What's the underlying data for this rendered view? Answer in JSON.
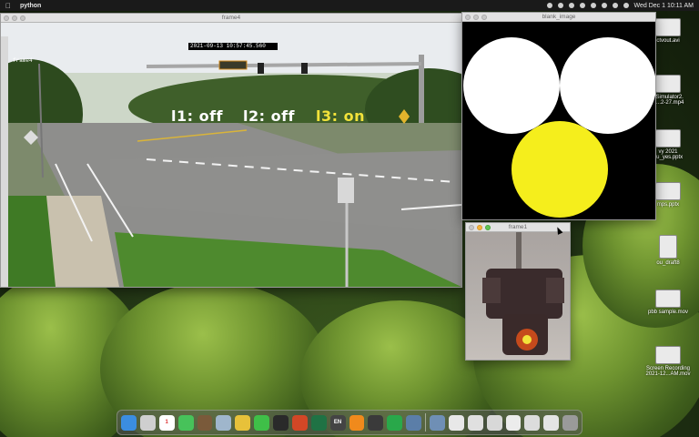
{
  "menubar": {
    "app_name": "python",
    "datetime": "Wed Dec 1  10:11 AM"
  },
  "windows": {
    "frame4": {
      "title": "frame4",
      "label": "frame4",
      "timestamp": "2021-09-13 10:57:45.560",
      "status": [
        {
          "label": "l1:",
          "state": "off",
          "color": "#ffffff"
        },
        {
          "label": "l2:",
          "state": "off",
          "color": "#ffffff"
        },
        {
          "label": "l3:",
          "state": "on",
          "color": "#f2e23a"
        }
      ]
    },
    "blank_image": {
      "title": "blank_image",
      "lights": [
        {
          "color": "#ffffff",
          "state": "off"
        },
        {
          "color": "#ffffff",
          "state": "off"
        },
        {
          "color": "#f5ee1c",
          "state": "on"
        }
      ]
    },
    "frame1": {
      "title": "frame1"
    }
  },
  "desktop_icons": [
    {
      "label": "ctvout.avi",
      "icon": "video-file-icon"
    },
    {
      "label": "gSimulator2.\nC...2-27.mp4",
      "icon": "video-file-icon"
    },
    {
      "label": "vy 2021\nou_yes.pptx",
      "icon": "slides-file-icon"
    },
    {
      "label": "mps.pptx",
      "icon": "slides-file-icon"
    },
    {
      "label": "ou_draft8",
      "icon": "document-file-icon"
    },
    {
      "label": "pbb sample.mov",
      "icon": "video-file-icon"
    },
    {
      "label": "Screen Recording\n2021-12...AM.mov",
      "icon": "video-file-icon"
    }
  ],
  "dock": {
    "items": [
      {
        "name": "finder",
        "color": "#3b8de0",
        "text": ""
      },
      {
        "name": "launchpad",
        "color": "#cfcfcf",
        "text": ""
      },
      {
        "name": "calendar",
        "color": "#ffffff",
        "text": "1"
      },
      {
        "name": "messages",
        "color": "#47c25a",
        "text": ""
      },
      {
        "name": "terminal-dev",
        "color": "#7a5a3a",
        "text": ""
      },
      {
        "name": "preview",
        "color": "#9fb6cc",
        "text": ""
      },
      {
        "name": "chrome",
        "color": "#e7c13a",
        "text": ""
      },
      {
        "name": "wechat",
        "color": "#3fbf48",
        "text": ""
      },
      {
        "name": "terminal",
        "color": "#2a2a2a",
        "text": ""
      },
      {
        "name": "office",
        "color": "#d24726",
        "text": ""
      },
      {
        "name": "excel",
        "color": "#1f7244",
        "text": ""
      },
      {
        "name": "input-method",
        "color": "#444444",
        "text": "EN"
      },
      {
        "name": "vlc",
        "color": "#f08a1c",
        "text": ""
      },
      {
        "name": "activity",
        "color": "#3a3a3a",
        "text": ""
      },
      {
        "name": "facetime",
        "color": "#29a84a",
        "text": ""
      },
      {
        "name": "python",
        "color": "#5b7ea8",
        "text": ""
      },
      {
        "name": "downloads",
        "color": "#6f8fb5",
        "text": ""
      },
      {
        "name": "thumb-1",
        "color": "#e8e8e8",
        "text": ""
      },
      {
        "name": "thumb-2",
        "color": "#e0e0e0",
        "text": ""
      },
      {
        "name": "thumb-3",
        "color": "#d8d8d8",
        "text": ""
      },
      {
        "name": "thumb-4",
        "color": "#ececec",
        "text": ""
      },
      {
        "name": "thumb-5",
        "color": "#dcdcdc",
        "text": ""
      },
      {
        "name": "thumb-6",
        "color": "#e4e4e4",
        "text": ""
      },
      {
        "name": "trash",
        "color": "#9a9a9a",
        "text": ""
      }
    ]
  }
}
